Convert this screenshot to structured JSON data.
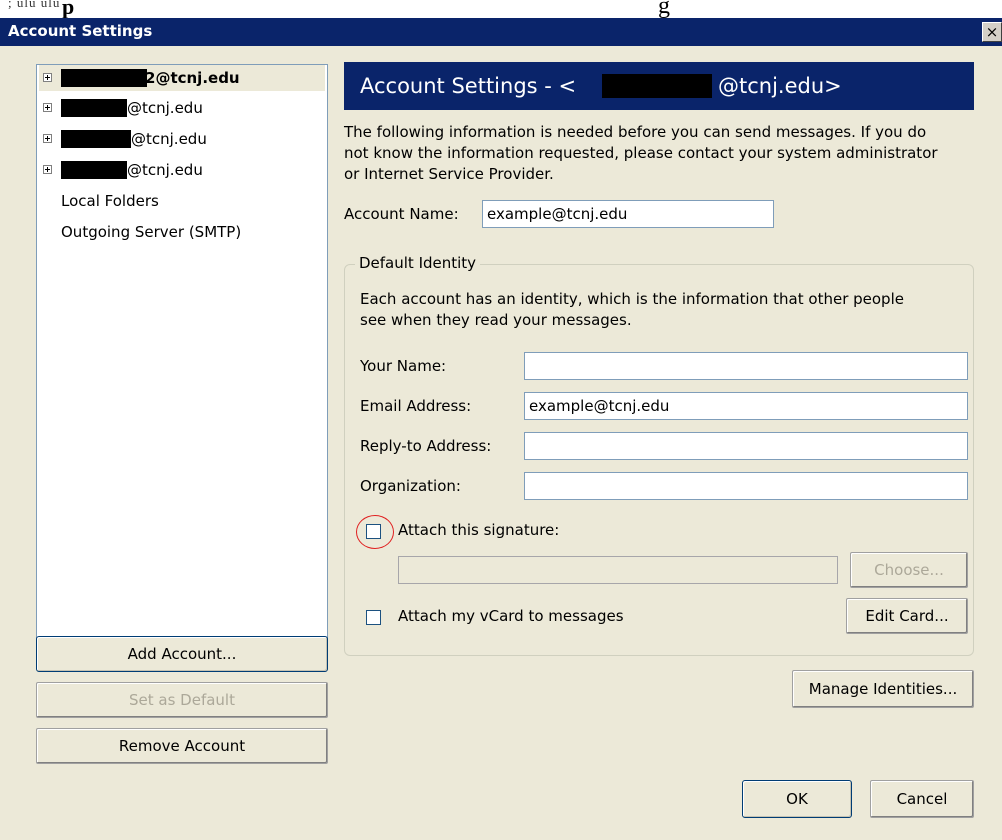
{
  "doc_fragment": {
    "left": "; ulu ulu",
    "mid": "p",
    "right": "g"
  },
  "window": {
    "title": "Account Settings",
    "close_glyph": "×"
  },
  "accounts": [
    {
      "suffix": "@tcnj.edu",
      "prefix": "2",
      "bold": true,
      "expander": true
    },
    {
      "suffix": "@tcnj.edu",
      "expander": true
    },
    {
      "suffix": "@tcnj.edu",
      "expander": true
    },
    {
      "suffix": "@tcnj.edu",
      "expander": true
    },
    {
      "label": "Local Folders"
    },
    {
      "label": "Outgoing Server (SMTP)"
    }
  ],
  "left_buttons": {
    "add_account": "Add Account...",
    "set_default": "Set as Default",
    "remove_account": "Remove Account"
  },
  "panel": {
    "header_prefix": "Account Settings - <",
    "header_suffix": "@tcnj.edu>",
    "info_lines": [
      "The following information is needed before you can send messages. If you do",
      "not know the information requested, please contact your system administrator",
      "or Internet Service Provider."
    ],
    "account_name_label": "Account Name:",
    "account_name_value": "example@tcnj.edu",
    "identity_legend": "Default Identity",
    "identity_desc_lines": [
      "Each account has an identity, which is the information that other people",
      "see when they read your messages."
    ],
    "your_name_label": "Your Name:",
    "your_name_value": "",
    "email_label": "Email Address:",
    "email_value": "example@tcnj.edu",
    "reply_to_label": "Reply-to Address:",
    "reply_to_value": "",
    "organization_label": "Organization:",
    "organization_value": "",
    "attach_signature_label": "Attach this signature:",
    "attach_signature_checked": false,
    "signature_path_value": "",
    "choose_button": "Choose...",
    "attach_vcard_label": "Attach my vCard to messages",
    "attach_vcard_checked": false,
    "edit_card_button": "Edit Card...",
    "manage_identities_button": "Manage Identities..."
  },
  "footer": {
    "ok": "OK",
    "cancel": "Cancel"
  },
  "colors": {
    "title_bar": "#0a246a",
    "dialog_bg": "#ece9d8",
    "highlight_ring": "#e02020"
  }
}
